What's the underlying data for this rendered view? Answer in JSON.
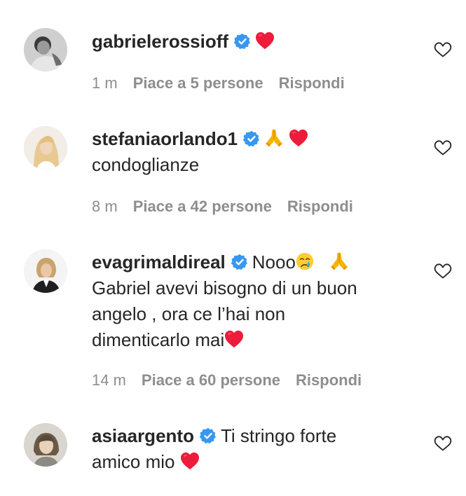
{
  "comments": [
    {
      "username": "gabrielerossioff",
      "verified": true,
      "text": "",
      "lines": [],
      "time": "1 m",
      "likes": "Piace a 5 persone",
      "reply": "Rispondi"
    },
    {
      "username": "stefaniaorlando1",
      "verified": true,
      "text": "",
      "lines": [
        "condoglianze"
      ],
      "time": "8 m",
      "likes": "Piace a 42 persone",
      "reply": "Rispondi"
    },
    {
      "username": "evagrimaldireal",
      "verified": true,
      "text": "Nooo",
      "lines": [
        "Gabriel avevi bisogno di un buon",
        "angelo , ora ce l’hai non",
        "dimenticarlo mai"
      ],
      "time": "14 m",
      "likes": "Piace a 60 persone",
      "reply": "Rispondi"
    },
    {
      "username": "asiaargento",
      "verified": true,
      "text": "Ti stringo forte",
      "lines": [
        "amico mio"
      ],
      "time": "",
      "likes": "",
      "reply": ""
    }
  ],
  "icons": {
    "verified": "verified-badge-icon",
    "like": "heart-outline-icon",
    "heart_emoji": "red-heart-emoji",
    "pray_emoji": "folded-hands-emoji",
    "cry_emoji": "crying-face-emoji"
  },
  "colors": {
    "verified": "#3897f0",
    "meta": "#8e8e8e",
    "text": "#262626",
    "heart": "#ed1c3a"
  }
}
